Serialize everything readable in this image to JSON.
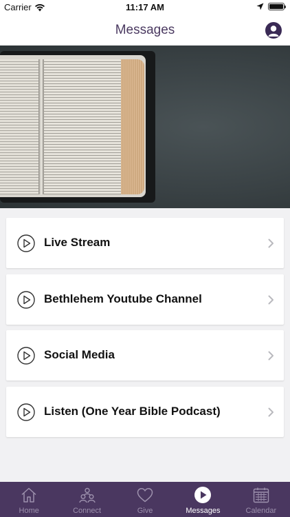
{
  "status": {
    "carrier": "Carrier",
    "time": "11:17 AM"
  },
  "nav": {
    "title": "Messages"
  },
  "items": [
    {
      "label": "Live Stream"
    },
    {
      "label": "Bethlehem Youtube Channel"
    },
    {
      "label": "Social Media"
    },
    {
      "label": "Listen (One Year Bible Podcast)"
    }
  ],
  "tabs": [
    {
      "label": "Home",
      "icon": "home-icon"
    },
    {
      "label": "Connect",
      "icon": "people-icon"
    },
    {
      "label": "Give",
      "icon": "heart-icon"
    },
    {
      "label": "Messages",
      "icon": "play-icon"
    },
    {
      "label": "Calendar",
      "icon": "calendar-icon"
    }
  ],
  "active_tab": "Messages",
  "colors": {
    "tab_bar": "#4a3760",
    "nav_title": "#4b3a61",
    "background": "#f1f1f3"
  }
}
